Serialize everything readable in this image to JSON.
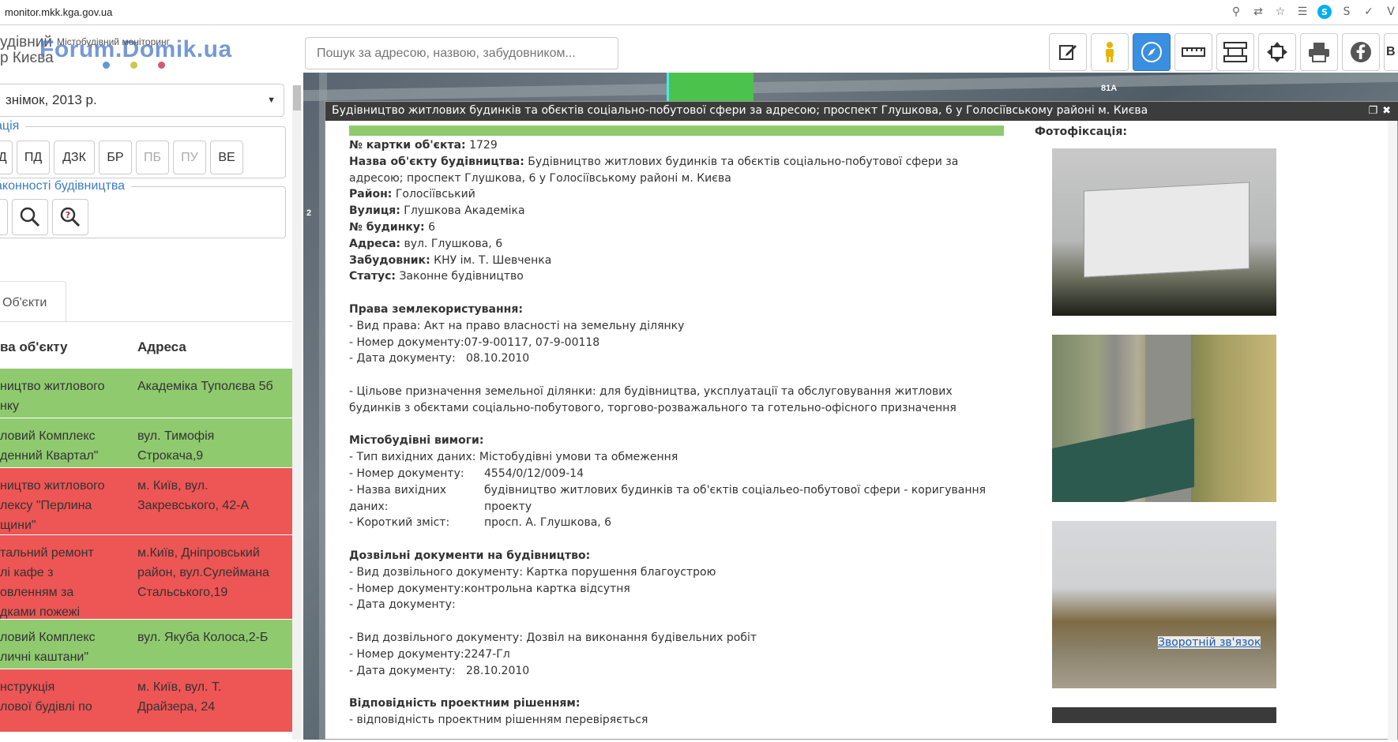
{
  "browser": {
    "url": "monitor.mkk.kga.gov.ua",
    "icons": [
      "zoom-icon",
      "translate-icon",
      "star-icon",
      "extension-icon",
      "skype-icon",
      "skype-gray-icon",
      "check-icon",
      "v-icon"
    ]
  },
  "header": {
    "brand_line1": "удівний",
    "brand_line2": "р Києва",
    "brand_small": "Містобудівний моніторинг",
    "watermark": "Forum.Domik.ua",
    "dot_colors": [
      "#5b9bd5",
      "#c9c94a",
      "#d05a6e"
    ],
    "search_placeholder": "Пошук за адресою, назвою, забудовником...",
    "toolbar": [
      "edit-icon",
      "person-icon",
      "compass-icon",
      "ruler-icon",
      "measure-icon",
      "move-icon",
      "print-icon",
      "facebook-icon"
    ],
    "toolbar_cut_label": "B"
  },
  "sidebar": {
    "year": "знімок, 2013 р.",
    "category_legend": "ація",
    "categories": [
      "ВД",
      "ПД",
      "ДЗК",
      "БР",
      "ПБ",
      "ПУ",
      "ВЕ"
    ],
    "legality_legend": "аконності будівництва",
    "tab": "Об'єкти",
    "col_name": "ва об'єкту",
    "col_address": "Адреса",
    "rows": [
      {
        "name": "ництво житлового\nнку",
        "address": "Академіка Туполєва 5б",
        "status": "green"
      },
      {
        "name": "ловий Комплекс\nденний Квартал\"",
        "address": "вул. Тимофія\nСтрокача,9",
        "status": "green"
      },
      {
        "name": "ництво житлового\nлексу \"Перлина\nщини\"",
        "address": "м. Київ, вул.\nЗакревського, 42-А",
        "status": "red"
      },
      {
        "name": "тальний ремонт\nлі кафе з\nовленням за\nдками пожежі",
        "address": "м.Київ, Дніпровський\nрайон, вул.Сулеймана\nСтальського,19",
        "status": "red"
      },
      {
        "name": "ловий Комплекс\nличні каштани\"",
        "address": "вул. Якуба Колоса,2-Б",
        "status": "green"
      },
      {
        "name": "нструкція\nлової будівлі по",
        "address": "м. Київ, вул. Т.\nДрайзера, 24",
        "status": "red"
      }
    ]
  },
  "map": {
    "label_81a": "81А",
    "label_2": "2"
  },
  "popup": {
    "title": "Будівництво житлових будинків та обєктів соціально-побутової сфери за адресою; проспект Глушкова, 6 у Голосіївському районі м. Києва",
    "card_label": "№ картки об'єкта:",
    "card_value": "1729",
    "name_label": "Назва об'єкту будівництва:",
    "name_value": "Будівництво житлових будинків та обєктів соціально-побутової сфери за",
    "name_value2": "адресою; проспект Глушкова, 6 у Голосіївському районі м. Києва",
    "district_label": "Район:",
    "district_value": "Голосіївський",
    "street_label": "Вулиця:",
    "street_value": "Глушкова Академіка",
    "house_label": "№ будинку:",
    "house_value": "6",
    "address_label": "Адреса:",
    "address_value": "вул. Глушкова, 6",
    "developer_label": "Забудовник:",
    "developer_value": "КНУ ім. Т. Шевченка",
    "status_label": "Статус:",
    "status_value": "Законне будівництво",
    "land_title": "Права землекористування:",
    "land_line1": "- Вид права: Акт на право власності на земельну ділянку",
    "land_line2": "- Номер документу:07-9-00117, 07-9-00118",
    "land_line3": "- Дата документу:   08.10.2010",
    "purpose_line1": "- Цільове призначення земельної ділянки: для будівництва, укcплуатації та обслуговування житлових",
    "purpose_line2": "будинків з обєктами соціально-побутового, торгово-розважального та готельно-офісного призначення",
    "urban_title": "Містобудівні вимоги:",
    "urban_line1": "- Тип вихідних даних: Містобудівні умови та обмеження",
    "urban_doc_label": "- Номер документу:",
    "urban_doc_value": "4554/0/12/009-14",
    "urban_name_label": "- Назва вихідних\nданих:",
    "urban_name_value": "будівництво житлових будинків та об'єктів соціальео-побутової сфери - коригування проекту",
    "urban_short_label": "- Короткий зміст:",
    "urban_short_value": "просп. А. Глушкова, 6",
    "permit_title": "Дозвільні документи на будівництво:",
    "permit1_line1": "- Вид дозвільного документу: Картка порушення благоустрою",
    "permit1_line2": "- Номер документу:контрольна картка відсутня",
    "permit1_line3": "- Дата документу:",
    "permit2_line1": "- Вид дозвільного документу: Дозвіл на виконання будівельних робіт",
    "permit2_line2": "- Номер документу:2247-Гл",
    "permit2_line3": "- Дата документу:   28.10.2010",
    "compliance_title": "Відповідність проектним рішенням:",
    "compliance_line1": "- відповідність проектним рішенням перевіряється",
    "photos_title": "Фотофіксація:",
    "feedback": "Зворотній зв'язок"
  }
}
